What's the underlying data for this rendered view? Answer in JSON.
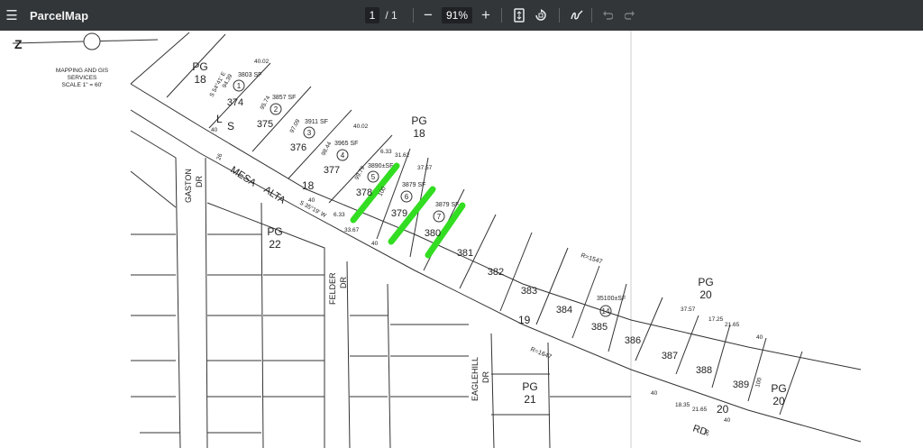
{
  "toolbar": {
    "menu_icon": "hamburger-menu-icon",
    "app_title": "ParcelMap",
    "page_current": "1",
    "page_separator": "/",
    "page_total": "1",
    "zoom_out": "−",
    "zoom_value": "91%",
    "zoom_in": "+",
    "fit_icon": "fit-page-icon",
    "rotate_icon": "rotate-icon",
    "draw_icon": "annotate-icon",
    "undo_icon": "undo-icon",
    "redo_icon": "redo-icon"
  },
  "map": {
    "legend_lines": [
      "MAPPING AND GIS",
      "SERVICES",
      "SCALE 1\" = 60'"
    ],
    "page_refs": [
      "PG",
      "18",
      "PG",
      "18",
      "PG",
      "22",
      "PG",
      "20",
      "PG",
      "21",
      "PG",
      "20"
    ],
    "streets": [
      "MESA",
      "ALTA",
      "GASTON",
      "DR",
      "FELDER",
      "DR",
      "EAGLEHILL",
      "DR",
      "RD"
    ],
    "tract_labels": [
      "L",
      "S",
      "18",
      "19",
      "20"
    ],
    "lots": [
      "374",
      "375",
      "376",
      "377",
      "378",
      "379",
      "380",
      "381",
      "382",
      "383",
      "384",
      "385",
      "386",
      "387",
      "388",
      "389"
    ],
    "parcel_numbers": [
      "1",
      "2",
      "3",
      "4",
      "5",
      "6",
      "7",
      "14"
    ],
    "areas": [
      "3803 SF",
      "3857 SF",
      "3911 SF",
      "3965 SF",
      "3890±SF",
      "3879 SF",
      "3879 SF",
      "35100±SF"
    ],
    "dims": [
      "40.02",
      "94.39",
      "95.74",
      "97.09",
      "98.44",
      "99.79",
      "40.02",
      "31.62",
      "6.33",
      "37.57",
      "100",
      "40",
      "40",
      "40",
      "6.33",
      "33.67",
      "40",
      "37.57",
      "17.25",
      "21.65",
      "40",
      "18.35",
      "21.65",
      "40",
      "100",
      "26",
      "30"
    ],
    "bearings": [
      "S 54°41' E",
      "S 35°19' W"
    ],
    "curves": [
      "R=1547",
      "R=1647"
    ]
  },
  "colors": {
    "highlight": "#33dd22",
    "toolbar_bg": "#323639"
  }
}
